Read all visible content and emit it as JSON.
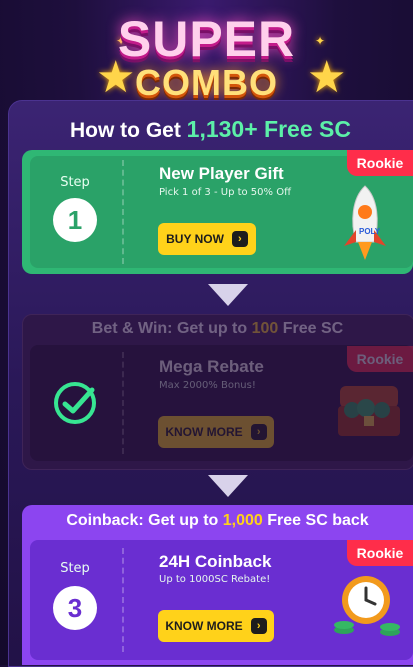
{
  "header": {
    "logo_top": "SUPER",
    "logo_bottom": "COMBO"
  },
  "promo": {
    "title_prefix": "How to Get ",
    "title_amount": "1,130+ Free SC"
  },
  "step1": {
    "step_word": "Step",
    "step_number": "1",
    "title": "New Player Gift",
    "subtitle": "Pick 1 of 3 - Up to 50% Off",
    "button": "BUY NOW",
    "badge": "Rookie",
    "illustration": "rocket-icon"
  },
  "step2": {
    "header_prefix": "Bet & Win: Get up to ",
    "header_amount": "100",
    "header_suffix": " Free SC",
    "title": "Mega Rebate",
    "subtitle": "Max 2000% Bonus!",
    "button": "KNOW MORE",
    "badge": "Rookie",
    "status_icon": "check-circle-icon",
    "illustration": "treasure-chest-icon"
  },
  "step3": {
    "header_prefix": "Coinback: Get up to ",
    "header_amount": "1,000",
    "header_suffix": " Free SC back",
    "step_word": "Step",
    "step_number": "3",
    "title": "24H Coinback",
    "subtitle": "Up to 1000SC Rebate!",
    "button": "KNOW MORE",
    "badge": "Rookie",
    "illustration": "clock-coins-icon"
  },
  "colors": {
    "accent_green": "#2fb774",
    "accent_purple": "#8c45f0",
    "button_yellow": "#ffd21a",
    "badge_red": "#ff2d4a",
    "highlight_green": "#5cf0a8",
    "highlight_yellow": "#ffd21a"
  }
}
